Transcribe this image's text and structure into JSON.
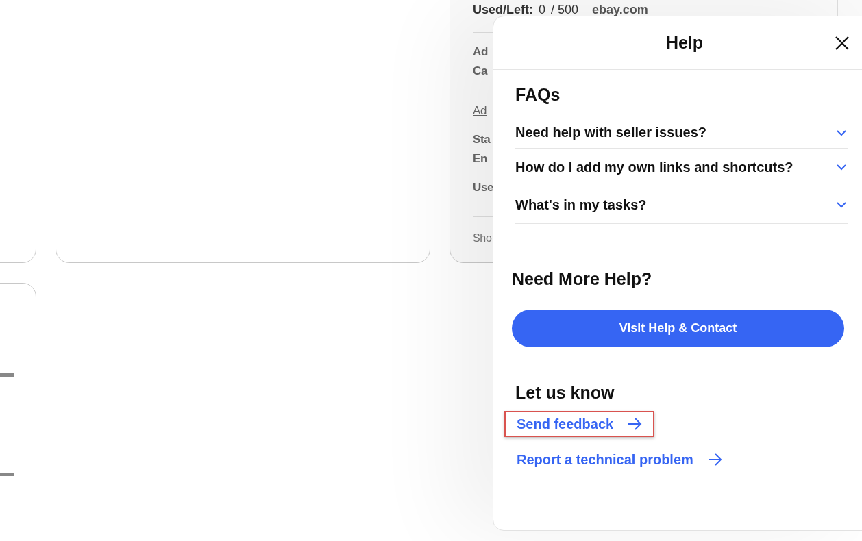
{
  "listing_card": {
    "usage_label": "Used/Left:",
    "usage_value": "0",
    "usage_total": "/ 500",
    "site": "ebay.com",
    "lines": [
      {
        "kind": "label",
        "text": "Ad"
      },
      {
        "kind": "label",
        "text": "Ca"
      },
      {
        "kind": "link",
        "text": "Ad"
      },
      {
        "kind": "label",
        "text": "Sta"
      },
      {
        "kind": "label",
        "text": "En"
      },
      {
        "kind": "label",
        "text": "Use"
      }
    ],
    "footer": "Sho"
  },
  "help_panel": {
    "title": "Help",
    "faqs_heading": "FAQs",
    "faqs": [
      {
        "question": "Need help with seller issues?",
        "expanded": false
      },
      {
        "question": "How do I add my own links and shortcuts?",
        "expanded": false
      },
      {
        "question": "What's in my tasks?",
        "expanded": false
      }
    ],
    "more_help_heading": "Need More Help?",
    "contact_button": "Visit Help & Contact",
    "feedback_heading": "Let us know",
    "links": [
      {
        "label": "Send feedback",
        "highlighted": true
      },
      {
        "label": "Report a technical problem",
        "highlighted": false
      }
    ]
  }
}
